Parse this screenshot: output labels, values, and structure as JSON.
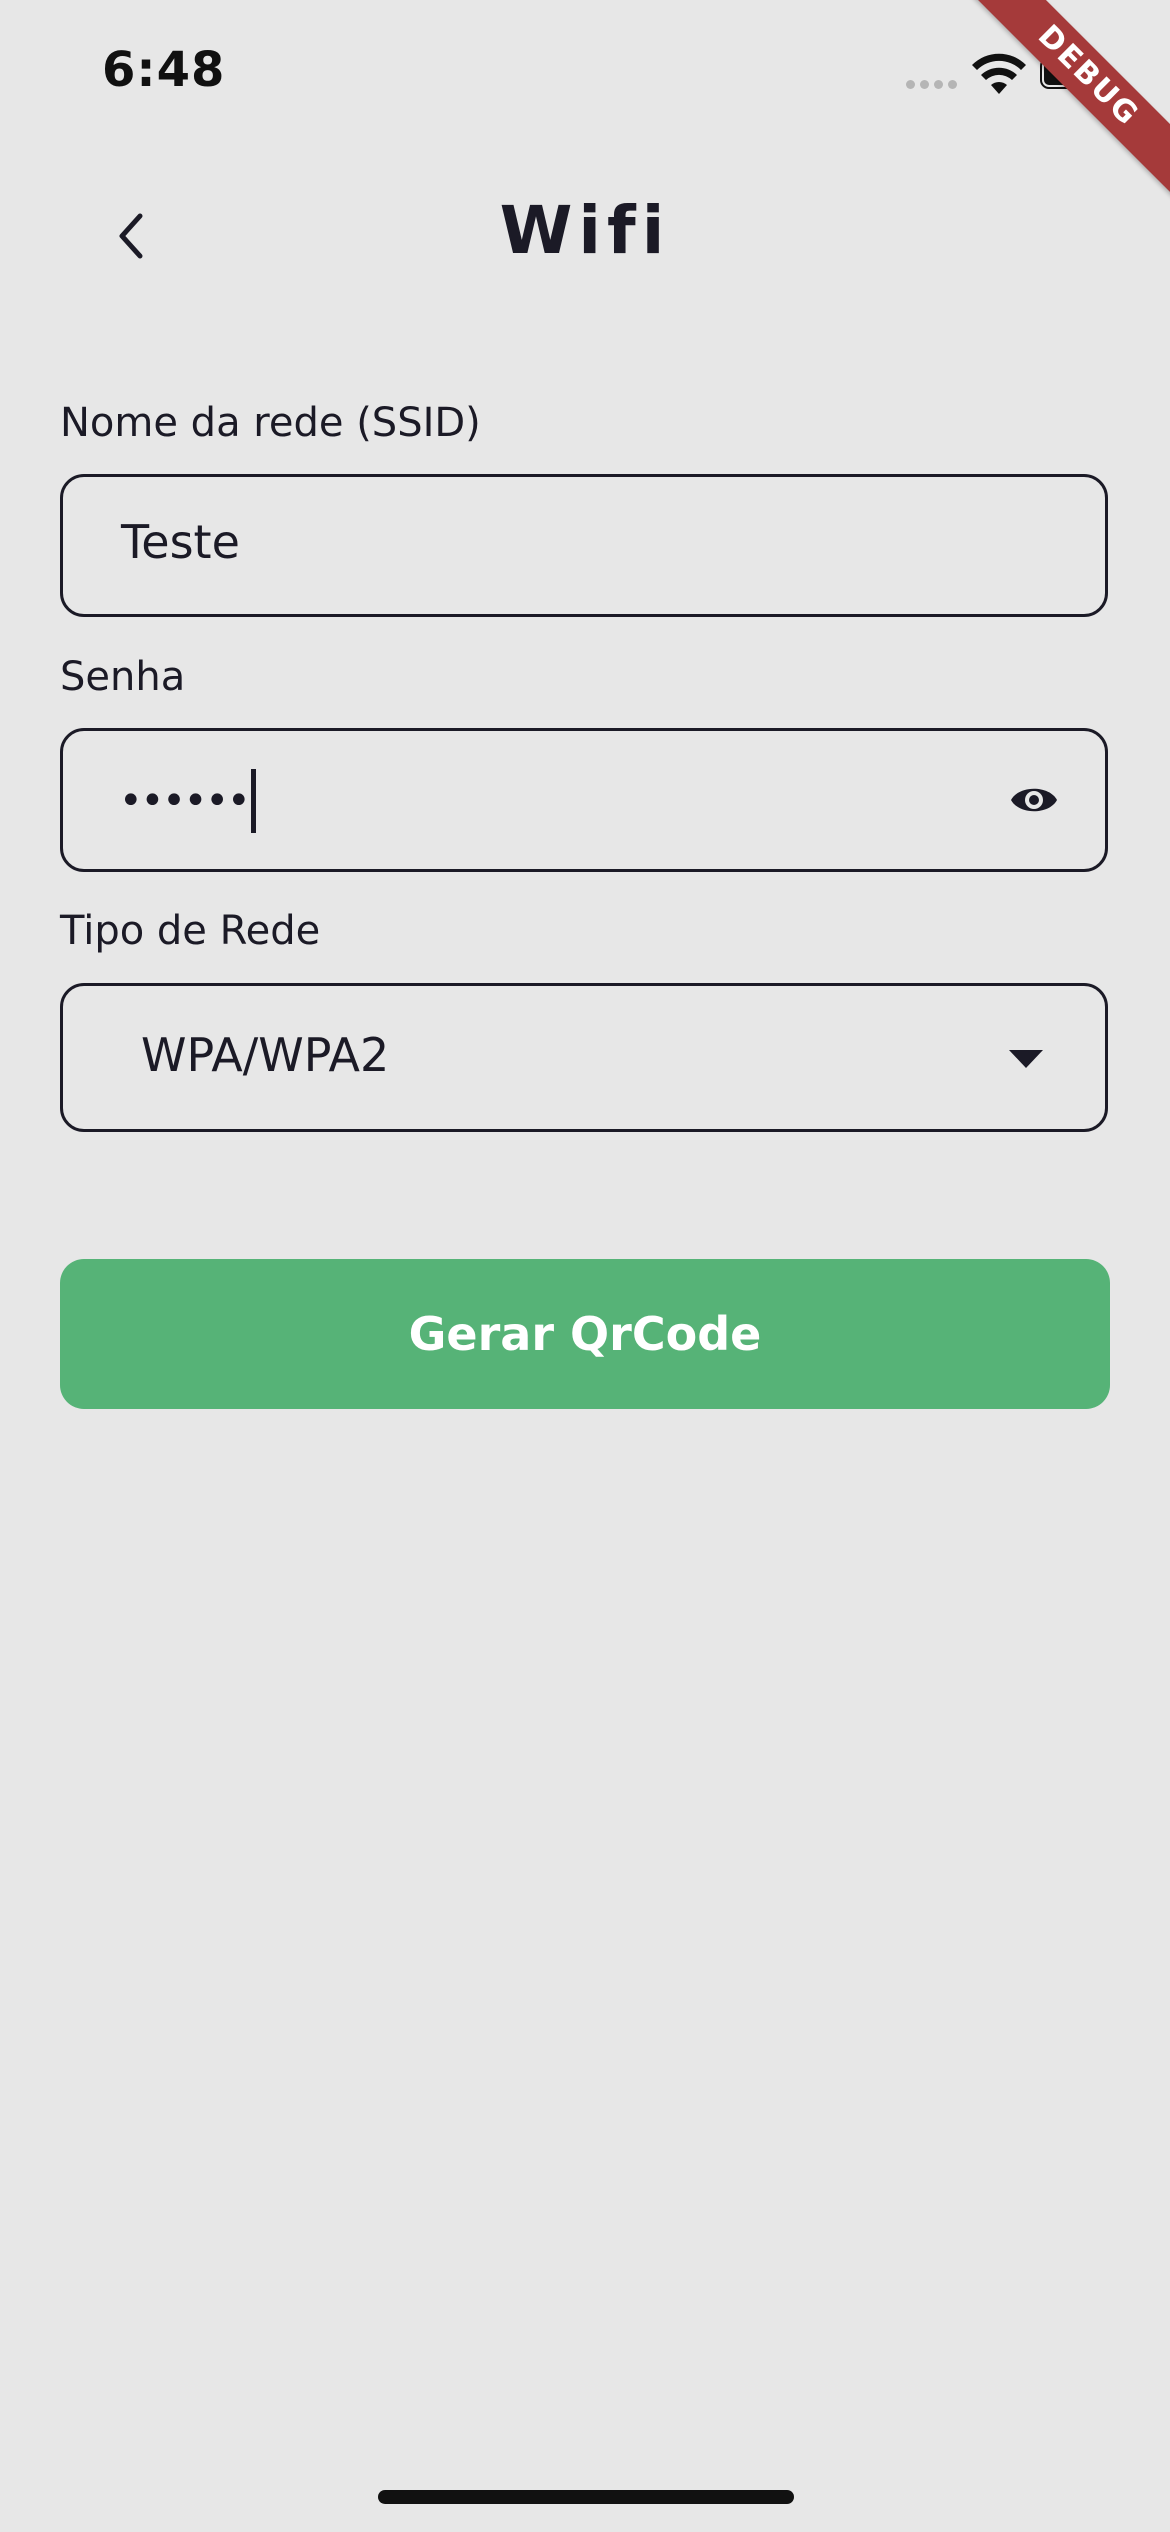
{
  "status_bar": {
    "time": "6:48"
  },
  "debug_banner": "DEBUG",
  "header": {
    "title": "Wifi",
    "back_icon": "chevron-left-icon"
  },
  "form": {
    "ssid": {
      "label": "Nome da rede (SSID)",
      "value": "Teste"
    },
    "password": {
      "label": "Senha",
      "value_masked": "••••••",
      "toggle_icon": "eye-icon"
    },
    "network_type": {
      "label": "Tipo de Rede",
      "selected": "WPA/WPA2",
      "dropdown_icon": "caret-down-icon"
    }
  },
  "actions": {
    "generate_label": "Gerar QrCode"
  },
  "colors": {
    "background": "#e7e7e7",
    "text": "#1b1a26",
    "primary_button": "#56b377",
    "debug_ribbon": "#a53a3a"
  }
}
